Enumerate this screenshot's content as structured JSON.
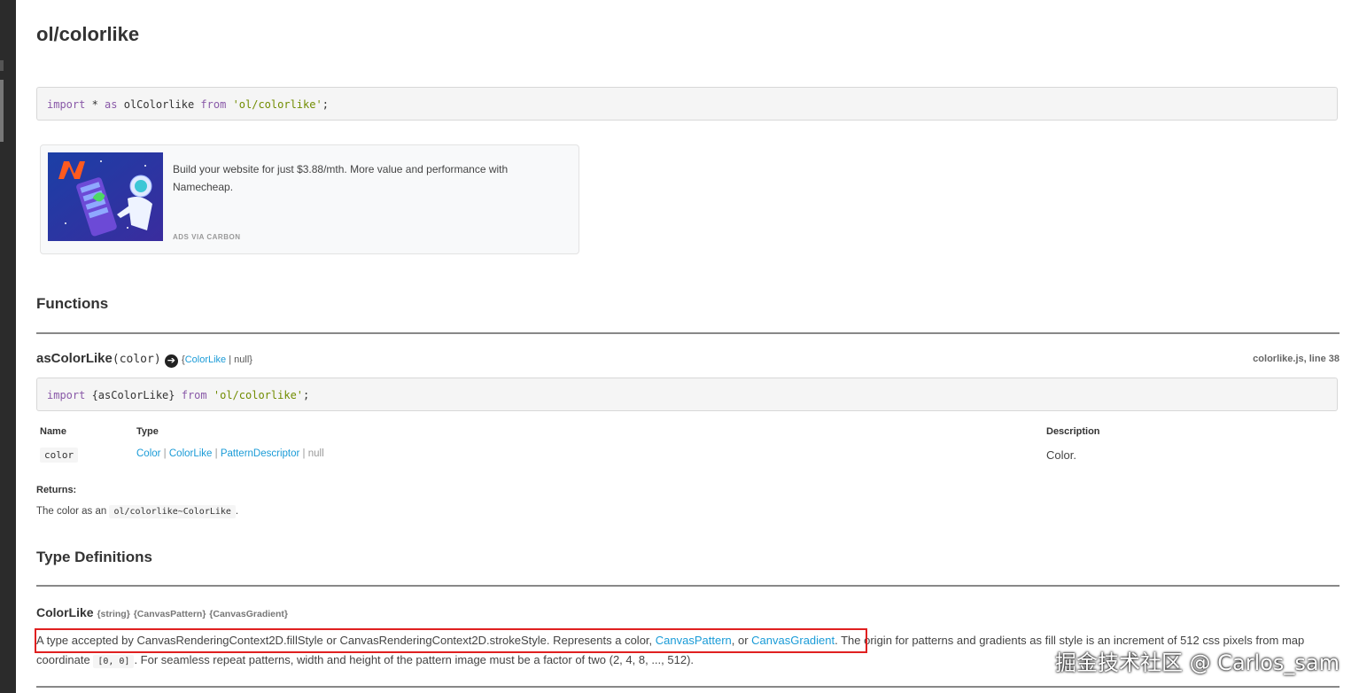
{
  "page": {
    "title": "ol/colorlike"
  },
  "import_code": {
    "kw1": "import",
    "star": " * ",
    "kw2": "as",
    "name": " olColorlike ",
    "kw3": "from",
    "space": " ",
    "module": "'ol/colorlike'",
    "semi": ";"
  },
  "ad": {
    "text": "Build your website for just $3.88/mth. More value and performance with Namecheap.",
    "via": "ADS VIA CARBON",
    "logo_icon": "namecheap-logo-icon"
  },
  "functions": {
    "heading": "Functions",
    "fn_name": "asColorLike",
    "fn_param": "(color)",
    "return_open": "{",
    "return_type": "ColorLike",
    "return_sep": " | ",
    "return_null": "null",
    "return_close": "}",
    "source": "colorlike.js, line 38",
    "import_kw": "import",
    "import_names": " {asColorLike} ",
    "import_from": "from",
    "import_module": "'ol/colorlike'",
    "import_semi": ";",
    "table": {
      "col_name": "Name",
      "col_type": "Type",
      "col_desc": "Description",
      "param_name": "color",
      "types": [
        "Color",
        "ColorLike",
        "PatternDescriptor"
      ],
      "type_sep": " | ",
      "type_null": "null",
      "desc": "Color."
    },
    "returns_label": "Returns:",
    "returns_prefix": "The color as an ",
    "returns_code": "ol/colorlike~ColorLike",
    "returns_suffix": "."
  },
  "typedefs": {
    "heading": "Type Definitions",
    "name": "ColorLike",
    "types": [
      "{string}",
      "{CanvasPattern}",
      "{CanvasGradient}"
    ],
    "desc_part1": "A type accepted by CanvasRenderingContext2D.fillStyle or CanvasRenderingContext2D.strokeStyle. Represents a color, ",
    "link1": "CanvasPattern",
    "desc_part2": ", or ",
    "link2": "CanvasGradient",
    "desc_part3": ". The origin for patterns and gradients as fill style is an increment of 512 css pixels from map coordinate ",
    "code": "[0, 0]",
    "desc_part4": ". For seamless repeat patterns, width and height of the pattern image must be a factor of two (2, 4, 8, ..., 512)."
  },
  "watermark": "掘金技术社区 @ Carlos_sam",
  "colors": {
    "link": "#1a9bd7",
    "keyword": "#8959a8",
    "string": "#718c00",
    "highlight": "#e02020"
  }
}
